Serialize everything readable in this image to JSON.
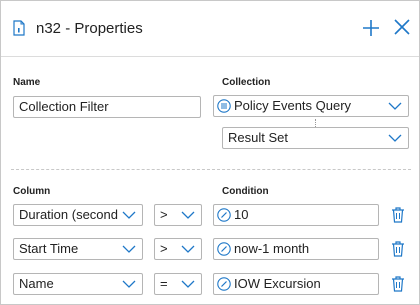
{
  "header": {
    "title": "n32 - Properties",
    "icons": [
      "document-icon",
      "plus-icon",
      "close-icon"
    ]
  },
  "name_section": {
    "label": "Name",
    "value": "Collection Filter"
  },
  "collection_section": {
    "label": "Collection",
    "query": "Policy Events Query",
    "result": "Result Set"
  },
  "columns_header": {
    "column": "Column",
    "condition": "Condition"
  },
  "rows": [
    {
      "column": "Duration (seconds",
      "operator": ">",
      "value": "10"
    },
    {
      "column": "Start Time",
      "operator": ">",
      "value": "now-1 month"
    },
    {
      "column": "Name",
      "operator": "=",
      "value": "IOW Excursion"
    }
  ],
  "colors": {
    "accent": "#1f78c8",
    "border": "#b5b5b5"
  }
}
